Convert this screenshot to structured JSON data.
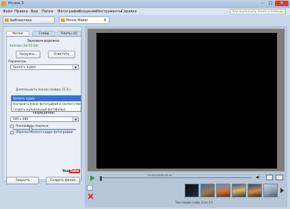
{
  "titlebar": {
    "title": "Picasa 3",
    "min": "–",
    "max": "□",
    "close": "✕"
  },
  "menu": [
    "Файл",
    "Правка",
    "Вид",
    "Папка",
    "Фотография",
    "Создание",
    "Инструменты",
    "Справка"
  ],
  "search_hint": "Как выполнить поиск в помощь на Google",
  "tabs": {
    "library": "Библиотека",
    "movie_maker": "Movie Maker"
  },
  "panel": {
    "subtabs": [
      "Фильм",
      "Слайд",
      "Клипы (4)"
    ],
    "soundtrack_header": "Звуковая дорожка:",
    "soundtrack_file": "Kalimba (00:05:58)",
    "load_button": "Загрузка...",
    "clear_button": "Очистить",
    "params_label": "Параметры",
    "audio_select_value": "Урезать аудио",
    "audio_options": [
      "Урезать аудио",
      "Настроить показ фотографий в соответствии со звуком",
      "Создать музыкальный фотофильм"
    ],
    "duration_text": "Длительность показа слайда: 21.6 с.",
    "overlap_text": "Наложение: 30%",
    "overlap_value": 0.3,
    "resolution_label": "Разрешение:",
    "resolution_value": "640 x 480",
    "show_captions": "Показывать подписи",
    "full_frame": "Обрезка полного кадра фотографии",
    "youtube_b": "You",
    "youtube_r": "Tube",
    "close_button": "Закрыть",
    "create_button": "Создать фильм"
  },
  "player": {
    "time": "00:00:00/00:00:00",
    "counter": "Текстовый слайд     (1 из 17)"
  },
  "colors": {
    "accent": "#3874d8",
    "youtube_red": "#d71e1e",
    "video_bg": "#000000"
  }
}
